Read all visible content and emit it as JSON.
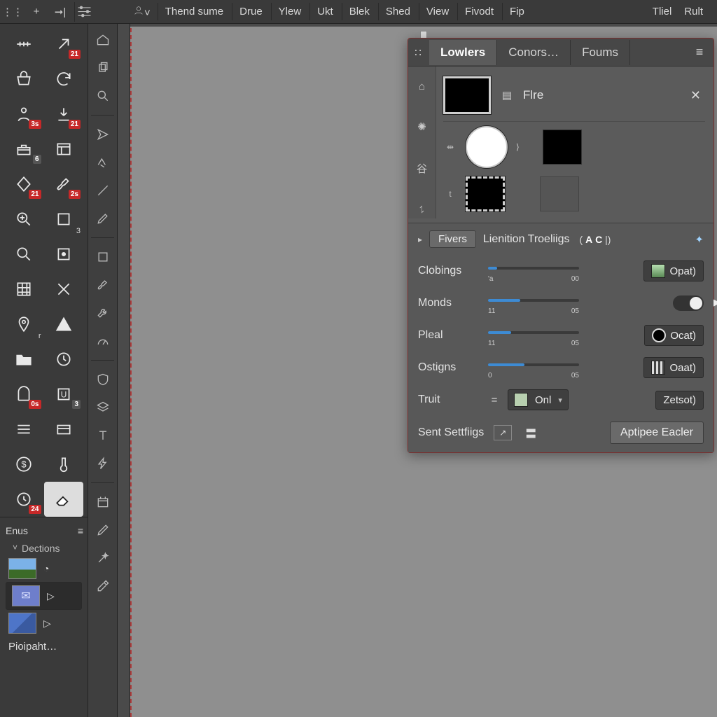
{
  "menubar": {
    "left_icons": [
      "handle",
      "plus",
      "align-right",
      "slider-icon",
      "user-icon"
    ],
    "items": [
      "Thend sume",
      "Drue",
      "Ylew",
      "Ukt",
      "Blek",
      "Shed",
      "View",
      "Fivodt",
      "Fip"
    ],
    "right": [
      "Tliel",
      "Rult"
    ]
  },
  "toolbox": {
    "tools": [
      {
        "name": "ruler-h-icon",
        "badge": ""
      },
      {
        "name": "arrow-ne-icon",
        "badge": "21"
      },
      {
        "name": "basket-icon",
        "badge": ""
      },
      {
        "name": "refresh-icon",
        "badge": ""
      },
      {
        "name": "person-icon",
        "badge": "3s"
      },
      {
        "name": "download-icon",
        "badge": "21"
      },
      {
        "name": "toolbox-icon",
        "badge": "6",
        "grey": true
      },
      {
        "name": "panel-icon",
        "badge": ""
      },
      {
        "name": "diamond-icon",
        "badge": "21"
      },
      {
        "name": "brush-icon",
        "badge": "2s"
      },
      {
        "name": "zoom-in-icon",
        "badge": ""
      },
      {
        "name": "square-3-icon",
        "sub": "3"
      },
      {
        "name": "zoom-icon",
        "badge": ""
      },
      {
        "name": "target-icon",
        "badge": ""
      },
      {
        "name": "grid-icon",
        "badge": ""
      },
      {
        "name": "cross-icon",
        "badge": ""
      },
      {
        "name": "pin-icon",
        "sub": "r"
      },
      {
        "name": "triangle-icon",
        "badge": ""
      },
      {
        "name": "folder-icon",
        "badge": ""
      },
      {
        "name": "clock-icon",
        "badge": ""
      },
      {
        "name": "arch-icon",
        "badge": "0s"
      },
      {
        "name": "u-icon",
        "badge": "3",
        "grey": true
      },
      {
        "name": "list-icon",
        "badge": ""
      },
      {
        "name": "card-icon",
        "badge": ""
      },
      {
        "name": "dollar-icon",
        "badge": ""
      },
      {
        "name": "thermo-icon",
        "badge": ""
      },
      {
        "name": "clock2-icon",
        "badge": "24"
      },
      {
        "name": "eraser-icon",
        "badge": "",
        "selected": true
      }
    ],
    "footer": {
      "title": "Enus",
      "section": "Dections",
      "rows": [
        "landscape",
        "folder",
        "cards"
      ],
      "bottom_label": "Pioipaht…"
    }
  },
  "panel": {
    "tabs": [
      "Lowlers",
      "Conors…",
      "Foums"
    ],
    "active_tab": 0,
    "layer_top": {
      "name": "Flre"
    },
    "section": {
      "chip": "Fivers",
      "title": "Lienition Troeliigs",
      "meta_a": "A",
      "meta_c": "C"
    },
    "props": [
      {
        "label": "Clobings",
        "tl": "'a",
        "tr": "00",
        "btn": "Opat)",
        "swatch": "pic"
      },
      {
        "label": "Monds",
        "tl": "11",
        "tr": "05",
        "toggle": true
      },
      {
        "label": "Pleal",
        "tl": "11",
        "tr": "05",
        "btn": "Ocat)",
        "swatch": "blk"
      },
      {
        "label": "Ostigns",
        "tl": "0",
        "tr": "05",
        "btn": "Oaat)",
        "swatch": "bars"
      }
    ],
    "truit": {
      "label": "Truit",
      "value": "Onl",
      "btn": "Zetsot)"
    },
    "footer": {
      "label": "Sent Settfiigs",
      "btn": "Aptipee Eacler"
    }
  }
}
